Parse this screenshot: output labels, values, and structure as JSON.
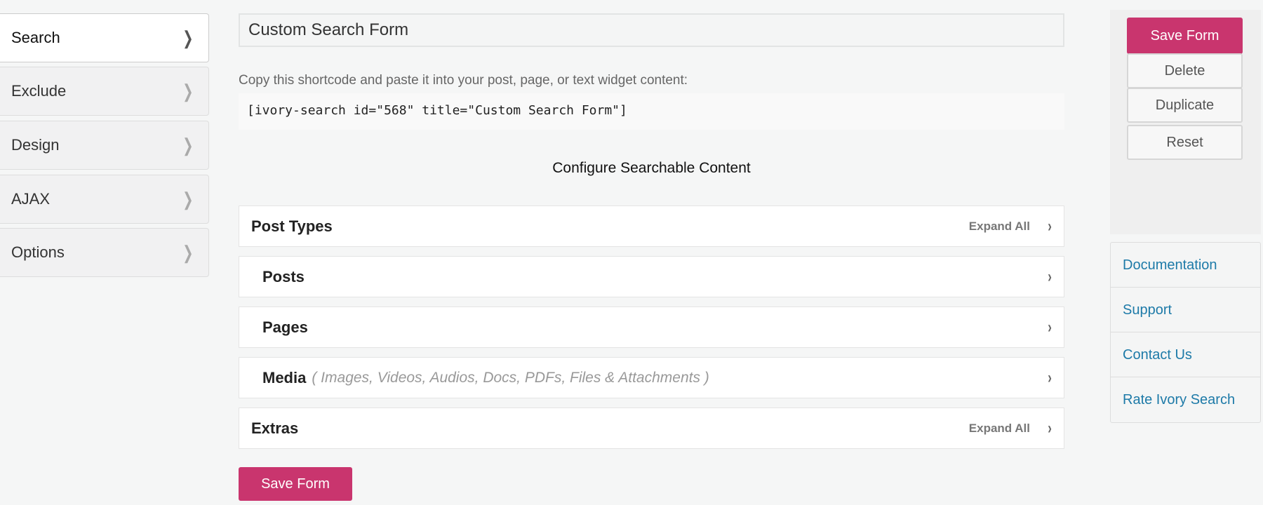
{
  "sidebar": {
    "items": [
      {
        "label": "Search"
      },
      {
        "label": "Exclude"
      },
      {
        "label": "Design"
      },
      {
        "label": "AJAX"
      },
      {
        "label": "Options"
      }
    ]
  },
  "form": {
    "title_value": "Custom Search Form",
    "copy_text": "Copy this shortcode and paste it into your post, page, or text widget content:",
    "shortcode": "[ivory-search id=\"568\" title=\"Custom Search Form\"]",
    "heading": "Configure Searchable Content",
    "rows": [
      {
        "label": "Post Types",
        "expand": "Expand All"
      },
      {
        "label": "Posts"
      },
      {
        "label": "Pages"
      },
      {
        "label": "Media",
        "hint": "( Images, Videos, Audios, Docs, PDFs, Files & Attachments )"
      },
      {
        "label": "Extras",
        "expand": "Expand All"
      }
    ],
    "save_label": "Save Form"
  },
  "actions": {
    "save": "Save Form",
    "delete": "Delete",
    "duplicate": "Duplicate",
    "reset": "Reset"
  },
  "links": [
    "Documentation",
    "Support",
    "Contact Us",
    "Rate Ivory Search"
  ],
  "colors": {
    "accent": "#c9356e",
    "link": "#1d7aa8"
  }
}
